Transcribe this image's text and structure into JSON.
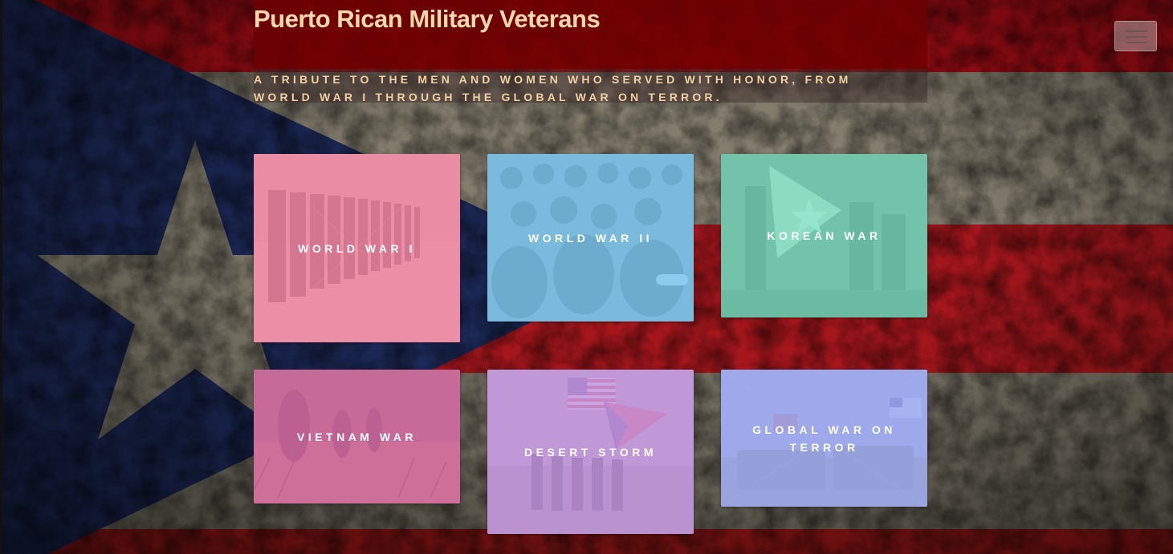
{
  "header": {
    "title": "Puerto Rican Military Veterans",
    "tagline": "A tribute to the men and women who served with honor, from World War I through the Global War on Terror.",
    "menu_icon": "hamburger-menu-icon"
  },
  "tiles": [
    {
      "label": "World War I",
      "color": "#e98aa0"
    },
    {
      "label": "World War II",
      "color": "#87c6ea"
    },
    {
      "label": "Korean War",
      "color": "#7fd4bc"
    },
    {
      "label": "Vietnam War",
      "color": "#d97fb6"
    },
    {
      "label": "Desert Storm",
      "color": "#c49ad8"
    },
    {
      "label": "Global War on Terror",
      "color": "#a0aaf0"
    }
  ],
  "colors": {
    "flag_red": "#a3161a",
    "flag_blue": "#1d2c5e",
    "title_text": "#fcd9a9",
    "title_bar": "#6e0000"
  }
}
